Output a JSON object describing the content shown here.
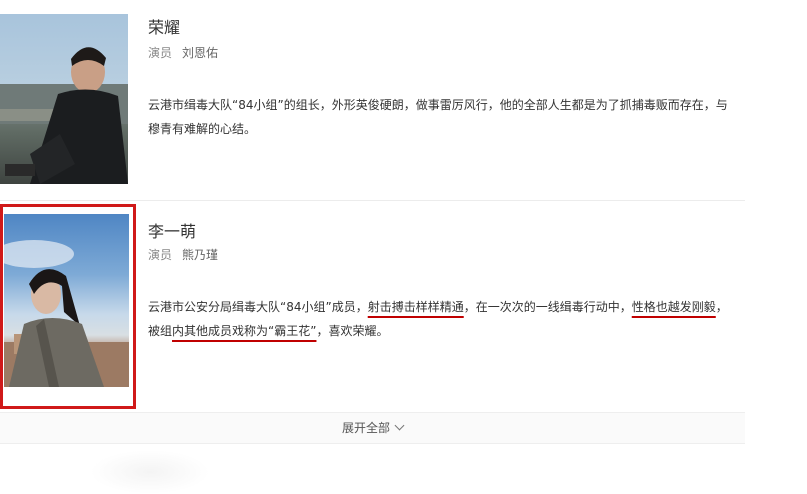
{
  "cast": [
    {
      "name": "荣耀",
      "role_label": "演员",
      "actor": "刘恩佑",
      "desc_parts": [
        {
          "text": "云港市缉毒大队“84小组”的组长，外形英俊硬朗，做事雷厉风行，他的全部人生都是为了抓捕毒贩而存在，与穆青有难解的心结。",
          "underline": false
        }
      ]
    },
    {
      "name": "李一萌",
      "role_label": "演员",
      "actor": "熊乃瑾",
      "desc_parts": [
        {
          "text": "云港市公安分局缉毒大队“84小组”成员，",
          "underline": false
        },
        {
          "text": "射击搏击样样精通",
          "underline": true
        },
        {
          "text": "，在一次次的一线缉毒行动中，",
          "underline": false
        },
        {
          "text": "性格也越发刚毅",
          "underline": true
        },
        {
          "text": "，被组",
          "underline": false
        },
        {
          "text": "内其他成员戏称为“霸王花”",
          "underline": true
        },
        {
          "text": "，喜欢荣耀。",
          "underline": false
        }
      ]
    }
  ],
  "expand": {
    "label": "展开全部"
  },
  "colors": {
    "highlight_frame": "#d01919",
    "underline": "#c00000"
  }
}
